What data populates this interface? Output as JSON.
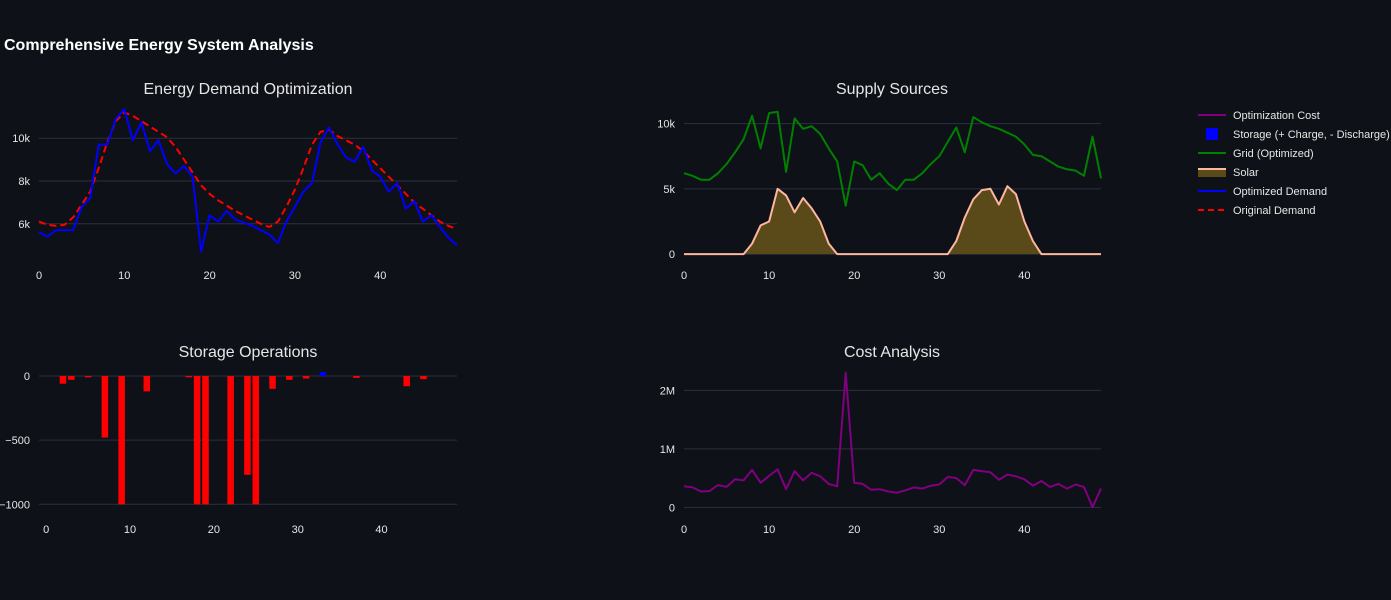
{
  "main_title": "Comprehensive Energy System Analysis",
  "legend": [
    {
      "label": "Optimization Cost",
      "color": "#800080",
      "kind": "line"
    },
    {
      "label": "Storage (+ Charge, - Discharge)",
      "color": "#0000ff",
      "kind": "square"
    },
    {
      "label": "Grid (Optimized)",
      "color": "#008000",
      "kind": "line"
    },
    {
      "label": "Solar",
      "color": "#ffb6a0",
      "fill": "#5a4a1a",
      "kind": "area"
    },
    {
      "label": "Optimized Demand",
      "color": "#0000ff",
      "kind": "line"
    },
    {
      "label": "Original Demand",
      "color": "#ff0000",
      "kind": "dash"
    }
  ],
  "chart_data": [
    {
      "type": "line",
      "title": "Energy Demand Optimization",
      "xlim": [
        0,
        49
      ],
      "ylim": [
        4400,
        11600
      ],
      "x_ticks": [
        0,
        10,
        20,
        30,
        40
      ],
      "y_ticks": [
        {
          "v": 6000,
          "label": "6k"
        },
        {
          "v": 8000,
          "label": "8k"
        },
        {
          "v": 10000,
          "label": "10k"
        }
      ],
      "series": [
        {
          "name": "Original Demand",
          "color": "#ff0000",
          "dash": true,
          "values": [
            6100,
            5950,
            5900,
            5950,
            6300,
            6900,
            7500,
            8600,
            9800,
            10800,
            11200,
            11050,
            10800,
            10550,
            10300,
            10050,
            9600,
            9000,
            8400,
            7800,
            7400,
            7100,
            6850,
            6600,
            6400,
            6200,
            6000,
            5850,
            6100,
            6800,
            7600,
            8600,
            9700,
            10300,
            10400,
            10100,
            9900,
            9700,
            9400,
            9000,
            8600,
            8200,
            7800,
            7400,
            7000,
            6700,
            6400,
            6100,
            5900,
            5750
          ]
        },
        {
          "name": "Optimized Demand",
          "color": "#0000ff",
          "dash": false,
          "values": [
            5600,
            5400,
            5700,
            5700,
            5700,
            6800,
            7200,
            9700,
            9700,
            10900,
            11350,
            9900,
            10750,
            9400,
            9900,
            8800,
            8350,
            8700,
            8200,
            4700,
            6400,
            6100,
            6600,
            6200,
            6050,
            5900,
            5700,
            5500,
            5100,
            6100,
            6800,
            7500,
            7900,
            9800,
            10500,
            9700,
            9100,
            8900,
            9600,
            8500,
            8200,
            7500,
            7900,
            6700,
            7050,
            6100,
            6400,
            5850,
            5350,
            5000
          ]
        }
      ]
    },
    {
      "type": "area",
      "title": "Supply Sources",
      "xlim": [
        0,
        49
      ],
      "ylim": [
        -300,
        11500
      ],
      "x_ticks": [
        0,
        10,
        20,
        30,
        40
      ],
      "y_ticks": [
        {
          "v": 0,
          "label": "0"
        },
        {
          "v": 5000,
          "label": "5k"
        },
        {
          "v": 10000,
          "label": "10k"
        }
      ],
      "series": [
        {
          "name": "Solar",
          "color": "#ffb6a0",
          "fill": "#5a4a1a",
          "values": [
            0,
            0,
            0,
            0,
            0,
            0,
            0,
            0,
            800,
            2200,
            2500,
            5000,
            4500,
            3200,
            4300,
            3500,
            2500,
            800,
            0,
            0,
            0,
            0,
            0,
            0,
            0,
            0,
            0,
            0,
            0,
            0,
            0,
            0,
            1000,
            2800,
            4200,
            4900,
            5000,
            3800,
            5200,
            4600,
            2500,
            1000,
            0,
            0,
            0,
            0,
            0,
            0,
            0,
            0
          ]
        },
        {
          "name": "Grid (Optimized)",
          "color": "#008000",
          "values": [
            6200,
            6000,
            5700,
            5700,
            6200,
            6900,
            7800,
            8800,
            10600,
            8100,
            10800,
            10900,
            6300,
            10400,
            9600,
            9800,
            9200,
            8100,
            7100,
            3700,
            7100,
            6800,
            5700,
            6200,
            5400,
            4900,
            5700,
            5700,
            6200,
            6900,
            7500,
            8600,
            9700,
            7800,
            10500,
            10100,
            9800,
            9600,
            9300,
            9000,
            8400,
            7600,
            7500,
            7100,
            6700,
            6500,
            6400,
            6000,
            9000,
            5800
          ]
        }
      ]
    },
    {
      "type": "bar",
      "title": "Storage Operations",
      "xlim": [
        -0.5,
        49
      ],
      "ylim": [
        -1060,
        70
      ],
      "x_ticks": [
        0,
        10,
        20,
        30,
        40
      ],
      "y_ticks": [
        {
          "v": 0,
          "label": "0"
        },
        {
          "v": -500,
          "label": "−500"
        },
        {
          "v": -1000,
          "label": "−1000"
        }
      ],
      "series": [
        {
          "name": "Storage (+ Charge, - Discharge)",
          "values": [
            0,
            0,
            -60,
            -30,
            0,
            -10,
            0,
            -480,
            0,
            -1000,
            0,
            0,
            -120,
            0,
            0,
            0,
            0,
            -10,
            -1000,
            -1000,
            0,
            0,
            -1000,
            0,
            -770,
            -1000,
            0,
            -100,
            0,
            -30,
            0,
            -20,
            0,
            30,
            0,
            0,
            0,
            -15,
            0,
            0,
            0,
            0,
            0,
            -80,
            0,
            -25,
            0,
            0,
            0,
            0
          ]
        }
      ]
    },
    {
      "type": "line",
      "title": "Cost Analysis",
      "xlim": [
        0,
        49
      ],
      "ylim": [
        -80000,
        2400000
      ],
      "x_ticks": [
        0,
        10,
        20,
        30,
        40
      ],
      "y_ticks": [
        {
          "v": 0,
          "label": "0"
        },
        {
          "v": 1000000,
          "label": "1M"
        },
        {
          "v": 2000000,
          "label": "2M"
        }
      ],
      "series": [
        {
          "name": "Optimization Cost",
          "color": "#800080",
          "values": [
            360000,
            340000,
            270000,
            280000,
            380000,
            350000,
            480000,
            460000,
            640000,
            420000,
            540000,
            650000,
            310000,
            620000,
            460000,
            590000,
            530000,
            400000,
            360000,
            2300000,
            420000,
            400000,
            300000,
            310000,
            270000,
            250000,
            290000,
            340000,
            320000,
            370000,
            390000,
            520000,
            500000,
            380000,
            640000,
            620000,
            600000,
            470000,
            560000,
            530000,
            480000,
            370000,
            450000,
            350000,
            400000,
            320000,
            390000,
            350000,
            0,
            320000
          ]
        }
      ]
    }
  ]
}
